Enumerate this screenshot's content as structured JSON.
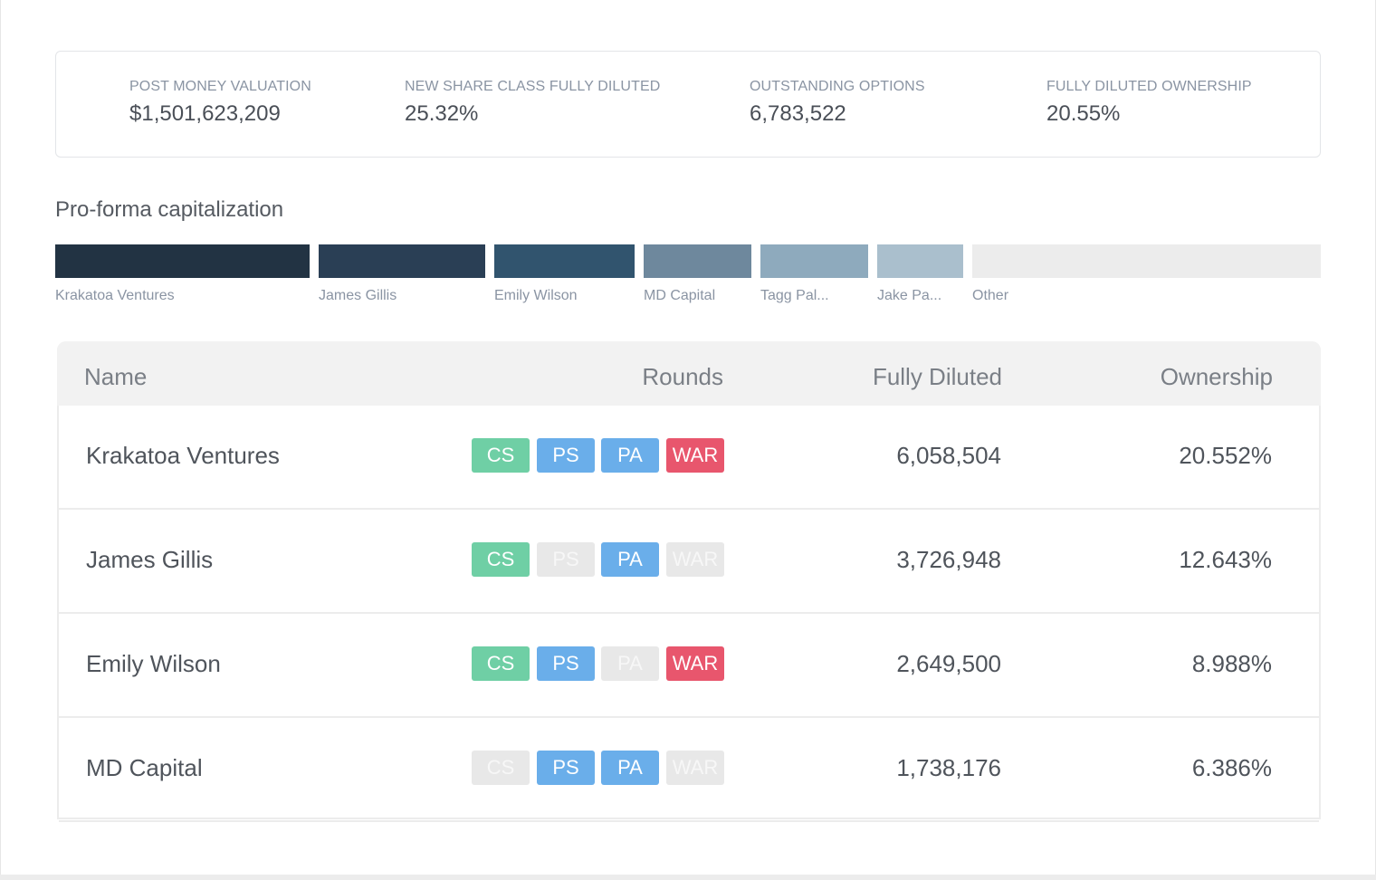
{
  "stats": [
    {
      "label": "POST MONEY VALUATION",
      "value": "$1,501,623,209"
    },
    {
      "label": "NEW SHARE CLASS FULLY DILUTED",
      "value": "25.32%"
    },
    {
      "label": "OUTSTANDING OPTIONS",
      "value": "6,783,522"
    },
    {
      "label": "FULLY DILUTED OWNERSHIP",
      "value": "20.55%"
    }
  ],
  "section_title": "Pro-forma capitalization",
  "capitalization_bar": [
    {
      "label": "Krakatoa Ventures",
      "color": "#223343"
    },
    {
      "label": "James Gillis",
      "color": "#2a3f55"
    },
    {
      "label": "Emily Wilson",
      "color": "#31546e"
    },
    {
      "label": "MD Capital",
      "color": "#6e889d"
    },
    {
      "label": "Tagg Pal...",
      "color": "#8eaabd"
    },
    {
      "label": "Jake Pa...",
      "color": "#aabfcd"
    },
    {
      "label": "Other",
      "color": "#ececec"
    }
  ],
  "table": {
    "headers": {
      "name": "Name",
      "rounds": "Rounds",
      "fully_diluted": "Fully Diluted",
      "ownership": "Ownership"
    },
    "round_labels": [
      "CS",
      "PS",
      "PA",
      "WAR"
    ],
    "round_colors": {
      "CS": "#6fcfa5",
      "PS": "#6aaeea",
      "PA": "#6aaeea",
      "WAR": "#e8566d"
    },
    "rows": [
      {
        "name": "Krakatoa Ventures",
        "rounds": {
          "CS": true,
          "PS": true,
          "PA": true,
          "WAR": true
        },
        "fully_diluted": "6,058,504",
        "ownership": "20.552%"
      },
      {
        "name": "James Gillis",
        "rounds": {
          "CS": true,
          "PS": false,
          "PA": true,
          "WAR": false
        },
        "fully_diluted": "3,726,948",
        "ownership": "12.643%"
      },
      {
        "name": "Emily Wilson",
        "rounds": {
          "CS": true,
          "PS": true,
          "PA": false,
          "WAR": true
        },
        "fully_diluted": "2,649,500",
        "ownership": "8.988%"
      },
      {
        "name": "MD Capital",
        "rounds": {
          "CS": false,
          "PS": true,
          "PA": true,
          "WAR": false
        },
        "fully_diluted": "1,738,176",
        "ownership": "6.386%"
      }
    ]
  }
}
